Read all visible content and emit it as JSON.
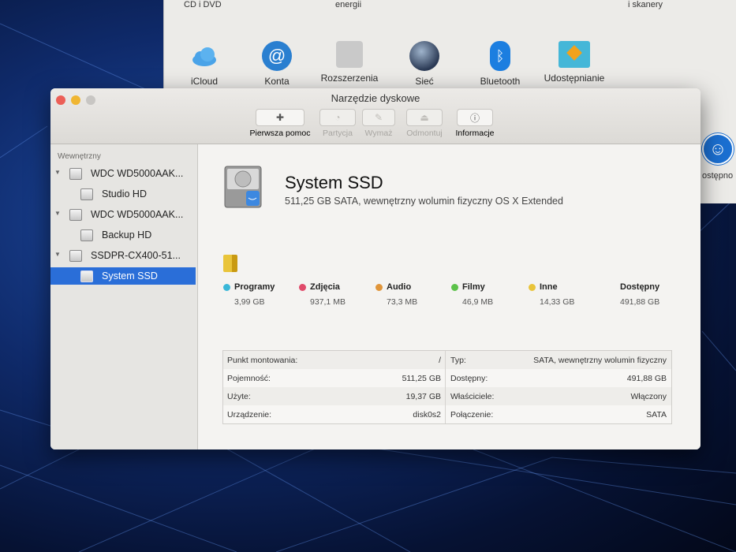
{
  "prefs": {
    "top_labels": [
      "CD i DVD",
      "energii",
      "i skanery"
    ],
    "items": [
      {
        "label": "iCloud",
        "icon": "icloud-icon"
      },
      {
        "label": "Konta",
        "icon": "at-icon"
      },
      {
        "label": "Rozszerzenia",
        "icon": "puzzle-icon"
      },
      {
        "label": "Sieć",
        "icon": "globe-icon"
      },
      {
        "label": "Bluetooth",
        "icon": "bluetooth-icon"
      },
      {
        "label": "Udostępnianie",
        "icon": "sharing-folder-icon"
      }
    ],
    "accessibility_label": "ostępno"
  },
  "window": {
    "title": "Narzędzie dyskowe",
    "toolbar": {
      "first_aid": "Pierwsza pomoc",
      "partition": "Partycja",
      "erase": "Wymaż",
      "unmount": "Odmontuj",
      "info": "Informacje"
    }
  },
  "sidebar": {
    "section": "Wewnętrzny",
    "items": [
      {
        "label": "WDC WD5000AAK..."
      },
      {
        "label": "Studio HD"
      },
      {
        "label": "WDC WD5000AAK..."
      },
      {
        "label": "Backup HD"
      },
      {
        "label": "SSDPR-CX400-51..."
      },
      {
        "label": "System SSD"
      }
    ]
  },
  "volume": {
    "name": "System SSD",
    "description": "511,25 GB SATA, wewnętrzny wolumin fizyczny OS X Extended"
  },
  "usage": [
    {
      "label": "Programy",
      "size": "3,99 GB",
      "color": "#3ab7d8"
    },
    {
      "label": "Zdjęcia",
      "size": "937,1 MB",
      "color": "#e04a6a"
    },
    {
      "label": "Audio",
      "size": "73,3 MB",
      "color": "#e0953a"
    },
    {
      "label": "Filmy",
      "size": "46,9 MB",
      "color": "#5cc24a"
    },
    {
      "label": "Inne",
      "size": "14,33 GB",
      "color": "#e9c43a"
    },
    {
      "label": "Dostępny",
      "size": "491,88 GB",
      "color": ""
    }
  ],
  "info": {
    "rows": [
      {
        "k1": "Punkt montowania:",
        "v1": "/",
        "k2": "Typ:",
        "v2": "SATA, wewnętrzny wolumin fizyczny"
      },
      {
        "k1": "Pojemność:",
        "v1": "511,25 GB",
        "k2": "Dostępny:",
        "v2": "491,88 GB"
      },
      {
        "k1": "Użyte:",
        "v1": "19,37 GB",
        "k2": "Właściciele:",
        "v2": "Włączony"
      },
      {
        "k1": "Urządzenie:",
        "v1": "disk0s2",
        "k2": "Połączenie:",
        "v2": "SATA"
      }
    ]
  },
  "colors": {
    "selection": "#2a6ed8",
    "close": "#ec5f57",
    "minimize": "#f0b632"
  }
}
